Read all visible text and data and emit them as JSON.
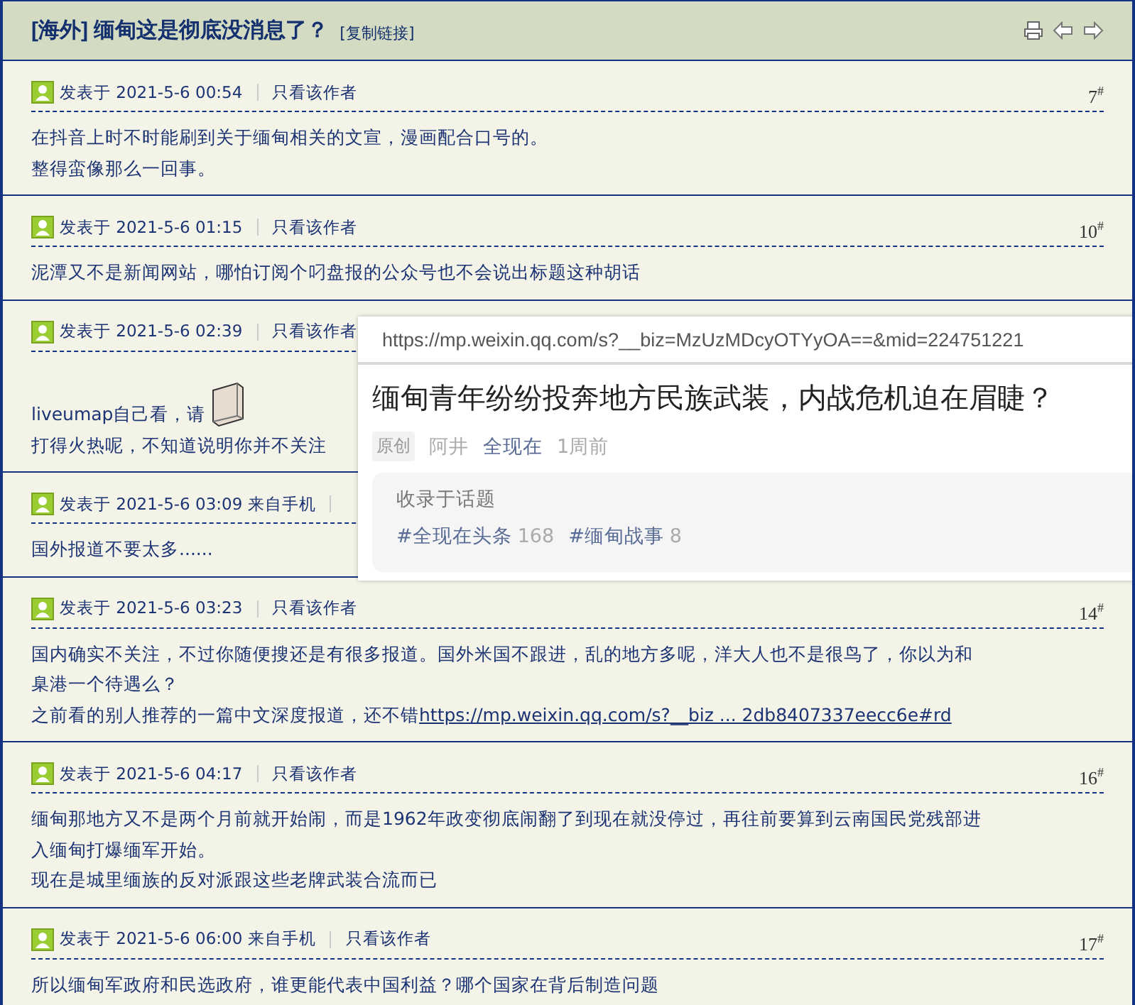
{
  "thread": {
    "title": "[海外] 缅甸这是彻底没消息了？",
    "copy_link": "[复制链接]"
  },
  "posts": [
    {
      "posted": "发表于 2021-5-6 00:54",
      "author_only": "只看该作者",
      "floor": "7$^{#}$",
      "lines": [
        {
          "text": "在抖音上时不时能刷到关于缅甸相关的文宣，漫画配合口号的。"
        },
        {
          "text": "整得蛮像那么一回事。"
        }
      ]
    },
    {
      "posted": "发表于 2021-5-6 01:15",
      "author_only": "只看该作者",
      "floor": "10$^{#}$",
      "lines": [
        {
          "text": "泥潭又不是新闻网站，哪怕订阅个叼盘报的公众号也不会说出标题这种胡话"
        }
      ]
    },
    {
      "posted": "发表于 2021-5-6 02:39",
      "author_only": "只看该作者",
      "lines": [
        {
          "text": "liveumap自己看，请",
          "emoticon": true
        },
        {
          "text": "打得火热呢，不知道说明你并不关注"
        }
      ]
    },
    {
      "posted": "发表于 2021-5-6 03:09 来自手机",
      "lines": [
        {
          "text": "国外报道不要太多......"
        }
      ]
    },
    {
      "posted": "发表于 2021-5-6 03:23",
      "author_only": "只看该作者",
      "floor": "14$^{#}$",
      "lines": [
        {
          "text": "国内确实不关注，不过你随便搜还是有很多报道。国外米国不跟进，乱的地方多呢，洋大人也不是很鸟了，你以为和"
        },
        {
          "text": "臬港一个待遇么？"
        },
        {
          "text": "之前看的别人推荐的一篇中文深度报道，还不错",
          "link": "https://mp.weixin.qq.com/s?__biz ... 2db8407337eecc6e#rd"
        }
      ]
    },
    {
      "posted": "发表于 2021-5-6 04:17",
      "author_only": "只看该作者",
      "floor": "16$^{#}$",
      "lines": [
        {
          "text": "缅甸那地方又不是两个月前就开始闹，而是1962年政变彻底闹翻了到现在就没停过，再往前要算到云南国民党残部进"
        },
        {
          "text": "入缅甸打爆缅军开始。"
        },
        {
          "text": "现在是城里缅族的反对派跟这些老牌武装合流而已"
        }
      ]
    },
    {
      "posted": "发表于 2021-5-6 06:00 来自手机",
      "author_only": "只看该作者",
      "floor": "17$^{#}$",
      "lines": [
        {
          "text": "所以缅甸军政府和民选政府，谁更能代表中国利益？哪个国家在背后制造问题"
        }
      ]
    }
  ],
  "link_preview": {
    "url": "https://mp.weixin.qq.com/s?__biz=MzUzMDcyOTYyOA==&mid=224751221",
    "title": "缅甸青年纷纷投奔地方民族武装，内战危机迫在眉睫？",
    "tag": "原创",
    "author": "阿井",
    "account": "全现在",
    "time": "1周前",
    "topics_label": "收录于话题",
    "topics": [
      {
        "name": "#全现在头条",
        "count": "168"
      },
      {
        "name": "#缅甸战事",
        "count": "8"
      }
    ]
  }
}
